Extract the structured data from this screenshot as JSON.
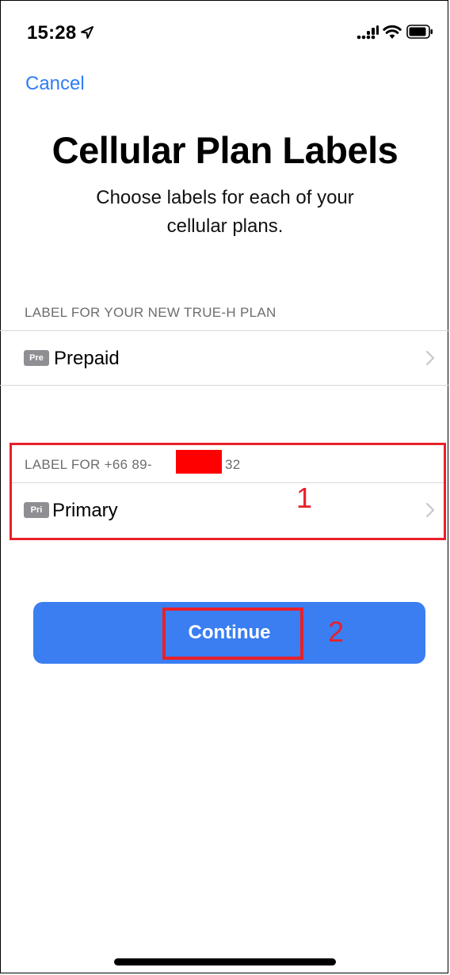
{
  "status_bar": {
    "time": "15:28"
  },
  "nav": {
    "cancel_label": "Cancel"
  },
  "header": {
    "title": "Cellular Plan Labels",
    "subtitle": "Choose labels for each of your cellular plans."
  },
  "sections": [
    {
      "header": "LABEL FOR YOUR NEW TRUE-H PLAN",
      "row": {
        "badge": "Pre",
        "label": "Prepaid"
      }
    },
    {
      "header_prefix": "LABEL FOR +66 89-",
      "header_suffix": "32",
      "row": {
        "badge": "Pri",
        "label": "Primary"
      }
    }
  ],
  "footer": {
    "continue_label": "Continue"
  },
  "annotations": {
    "box1_number": "1",
    "box2_number": "2"
  },
  "colors": {
    "accent": "#2f7df6",
    "button": "#3a7ef2",
    "annotation": "#e8202a",
    "redaction": "#ff0000"
  }
}
